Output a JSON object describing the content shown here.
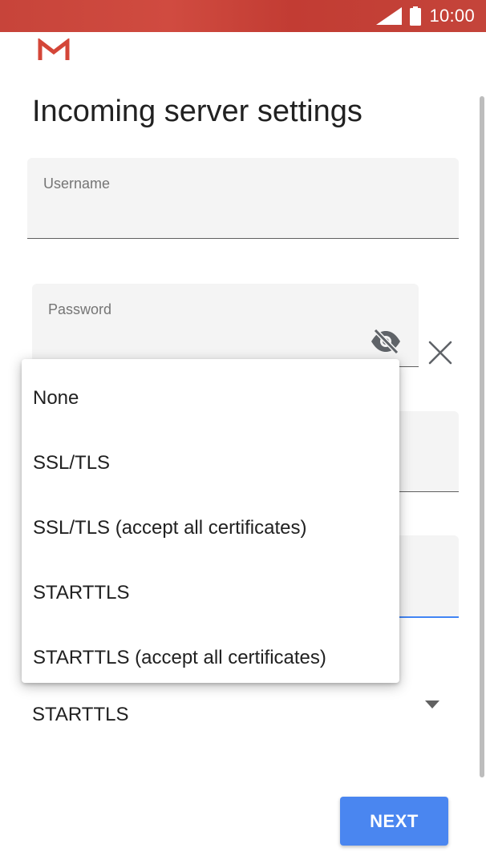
{
  "status_bar": {
    "time": "10:00",
    "icons": [
      "signal-icon",
      "battery-icon"
    ],
    "background_color": "#c7443a"
  },
  "app": {
    "logo": "gmail-logo",
    "logo_color": "#d44638"
  },
  "page": {
    "title": "Incoming server settings"
  },
  "form": {
    "username": {
      "label": "Username",
      "value": ""
    },
    "password": {
      "label": "Password",
      "value": ""
    },
    "security_type": {
      "selected": "STARTTLS"
    }
  },
  "dropdown": {
    "options": [
      "None",
      "SSL/TLS",
      "SSL/TLS (accept all certificates)",
      "STARTTLS",
      "STARTTLS (accept all certificates)"
    ]
  },
  "actions": {
    "next_label": "NEXT",
    "next_color": "#4a86f0"
  },
  "accent_color": "#4285f4"
}
